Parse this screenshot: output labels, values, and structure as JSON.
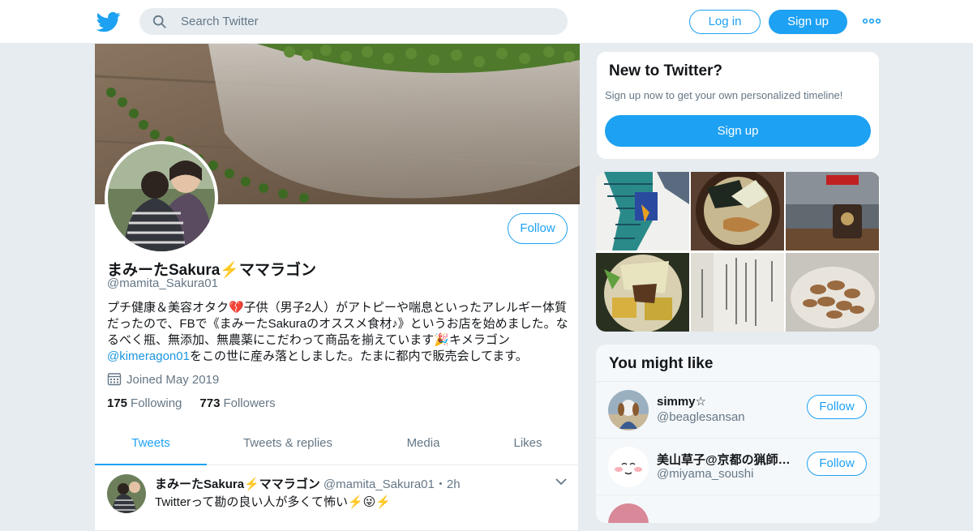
{
  "topbar": {
    "logo_icon": "twitter-bird-icon",
    "search_placeholder": "Search Twitter",
    "login_label": "Log in",
    "signup_label": "Sign up",
    "more_icon": "more-dots-icon"
  },
  "profile": {
    "follow_label": "Follow",
    "name": "まみーたSakura⚡️ママラゴン",
    "handle": "@mamita_Sakura01",
    "bio_part1": "プチ健康＆美容オタク💔子供（男子2人）がアトピーや喘息といったアレルギー体質だったので、FBで《まみーたSakuraのオススメ食材♪》というお店を始めました。なるべく瓶、無添加、無農薬にこだわって商品を揃えています🎉キメラゴン",
    "bio_link": "@kimeragon01",
    "bio_part2": "をこの世に産み落としました。たまに都内で販売会してます。",
    "joined": "Joined May 2019",
    "following_count": "175",
    "following_label": "Following",
    "followers_count": "773",
    "followers_label": "Followers"
  },
  "tabs": [
    "Tweets",
    "Tweets & replies",
    "Media",
    "Likes"
  ],
  "tweet": {
    "name": "まみーたSakura⚡️ママラゴン",
    "meta": "@mamita_Sakura01・2h",
    "text": "Twitterって勘の良い人が多くて怖い⚡️😜⚡️"
  },
  "sidebar": {
    "new_title": "New to Twitter?",
    "new_text": "Sign up now to get your own personalized timeline!",
    "new_button": "Sign up",
    "like_title": "You might like",
    "users": [
      {
        "name": "simmy☆",
        "handle": "@beaglesansan",
        "follow": "Follow"
      },
      {
        "name": "美山草子@京都の猟師…",
        "handle": "@miyama_soushi",
        "follow": "Follow"
      }
    ]
  },
  "colors": {
    "accent": "#1da1f2",
    "link": "#1b95e0",
    "muted": "#657786"
  }
}
